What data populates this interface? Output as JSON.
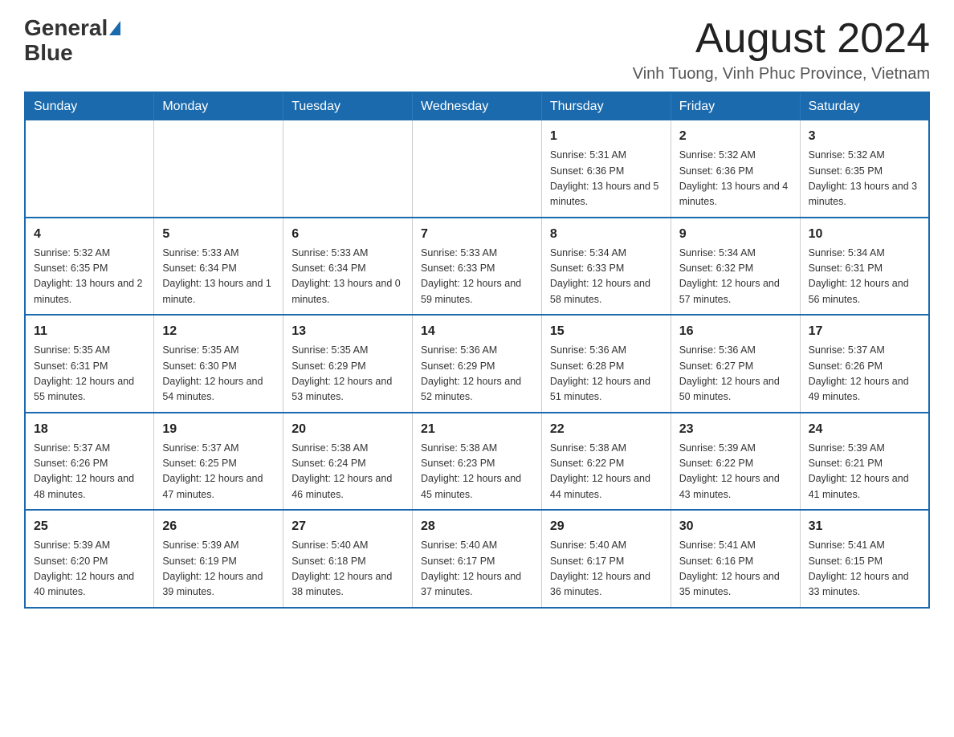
{
  "header": {
    "logo_general": "General",
    "logo_blue": "Blue",
    "month_title": "August 2024",
    "location": "Vinh Tuong, Vinh Phuc Province, Vietnam"
  },
  "weekdays": [
    "Sunday",
    "Monday",
    "Tuesday",
    "Wednesday",
    "Thursday",
    "Friday",
    "Saturday"
  ],
  "weeks": [
    [
      {
        "day": "",
        "info": ""
      },
      {
        "day": "",
        "info": ""
      },
      {
        "day": "",
        "info": ""
      },
      {
        "day": "",
        "info": ""
      },
      {
        "day": "1",
        "info": "Sunrise: 5:31 AM\nSunset: 6:36 PM\nDaylight: 13 hours and 5 minutes."
      },
      {
        "day": "2",
        "info": "Sunrise: 5:32 AM\nSunset: 6:36 PM\nDaylight: 13 hours and 4 minutes."
      },
      {
        "day": "3",
        "info": "Sunrise: 5:32 AM\nSunset: 6:35 PM\nDaylight: 13 hours and 3 minutes."
      }
    ],
    [
      {
        "day": "4",
        "info": "Sunrise: 5:32 AM\nSunset: 6:35 PM\nDaylight: 13 hours and 2 minutes."
      },
      {
        "day": "5",
        "info": "Sunrise: 5:33 AM\nSunset: 6:34 PM\nDaylight: 13 hours and 1 minute."
      },
      {
        "day": "6",
        "info": "Sunrise: 5:33 AM\nSunset: 6:34 PM\nDaylight: 13 hours and 0 minutes."
      },
      {
        "day": "7",
        "info": "Sunrise: 5:33 AM\nSunset: 6:33 PM\nDaylight: 12 hours and 59 minutes."
      },
      {
        "day": "8",
        "info": "Sunrise: 5:34 AM\nSunset: 6:33 PM\nDaylight: 12 hours and 58 minutes."
      },
      {
        "day": "9",
        "info": "Sunrise: 5:34 AM\nSunset: 6:32 PM\nDaylight: 12 hours and 57 minutes."
      },
      {
        "day": "10",
        "info": "Sunrise: 5:34 AM\nSunset: 6:31 PM\nDaylight: 12 hours and 56 minutes."
      }
    ],
    [
      {
        "day": "11",
        "info": "Sunrise: 5:35 AM\nSunset: 6:31 PM\nDaylight: 12 hours and 55 minutes."
      },
      {
        "day": "12",
        "info": "Sunrise: 5:35 AM\nSunset: 6:30 PM\nDaylight: 12 hours and 54 minutes."
      },
      {
        "day": "13",
        "info": "Sunrise: 5:35 AM\nSunset: 6:29 PM\nDaylight: 12 hours and 53 minutes."
      },
      {
        "day": "14",
        "info": "Sunrise: 5:36 AM\nSunset: 6:29 PM\nDaylight: 12 hours and 52 minutes."
      },
      {
        "day": "15",
        "info": "Sunrise: 5:36 AM\nSunset: 6:28 PM\nDaylight: 12 hours and 51 minutes."
      },
      {
        "day": "16",
        "info": "Sunrise: 5:36 AM\nSunset: 6:27 PM\nDaylight: 12 hours and 50 minutes."
      },
      {
        "day": "17",
        "info": "Sunrise: 5:37 AM\nSunset: 6:26 PM\nDaylight: 12 hours and 49 minutes."
      }
    ],
    [
      {
        "day": "18",
        "info": "Sunrise: 5:37 AM\nSunset: 6:26 PM\nDaylight: 12 hours and 48 minutes."
      },
      {
        "day": "19",
        "info": "Sunrise: 5:37 AM\nSunset: 6:25 PM\nDaylight: 12 hours and 47 minutes."
      },
      {
        "day": "20",
        "info": "Sunrise: 5:38 AM\nSunset: 6:24 PM\nDaylight: 12 hours and 46 minutes."
      },
      {
        "day": "21",
        "info": "Sunrise: 5:38 AM\nSunset: 6:23 PM\nDaylight: 12 hours and 45 minutes."
      },
      {
        "day": "22",
        "info": "Sunrise: 5:38 AM\nSunset: 6:22 PM\nDaylight: 12 hours and 44 minutes."
      },
      {
        "day": "23",
        "info": "Sunrise: 5:39 AM\nSunset: 6:22 PM\nDaylight: 12 hours and 43 minutes."
      },
      {
        "day": "24",
        "info": "Sunrise: 5:39 AM\nSunset: 6:21 PM\nDaylight: 12 hours and 41 minutes."
      }
    ],
    [
      {
        "day": "25",
        "info": "Sunrise: 5:39 AM\nSunset: 6:20 PM\nDaylight: 12 hours and 40 minutes."
      },
      {
        "day": "26",
        "info": "Sunrise: 5:39 AM\nSunset: 6:19 PM\nDaylight: 12 hours and 39 minutes."
      },
      {
        "day": "27",
        "info": "Sunrise: 5:40 AM\nSunset: 6:18 PM\nDaylight: 12 hours and 38 minutes."
      },
      {
        "day": "28",
        "info": "Sunrise: 5:40 AM\nSunset: 6:17 PM\nDaylight: 12 hours and 37 minutes."
      },
      {
        "day": "29",
        "info": "Sunrise: 5:40 AM\nSunset: 6:17 PM\nDaylight: 12 hours and 36 minutes."
      },
      {
        "day": "30",
        "info": "Sunrise: 5:41 AM\nSunset: 6:16 PM\nDaylight: 12 hours and 35 minutes."
      },
      {
        "day": "31",
        "info": "Sunrise: 5:41 AM\nSunset: 6:15 PM\nDaylight: 12 hours and 33 minutes."
      }
    ]
  ]
}
